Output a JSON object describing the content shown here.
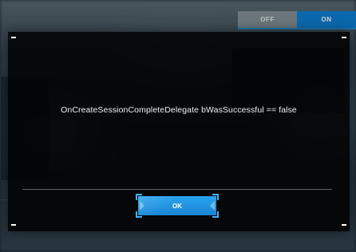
{
  "toggle": {
    "off_label": "OFF",
    "on_label": "ON",
    "selected": "ON"
  },
  "dialog": {
    "message": "OnCreateSessionCompleteDelegate bWasSuccessful == false",
    "ok_label": "OK"
  },
  "colors": {
    "accent": "#1a8bd8",
    "dialog_bg": "#000000",
    "text": "#f2f2f2"
  }
}
